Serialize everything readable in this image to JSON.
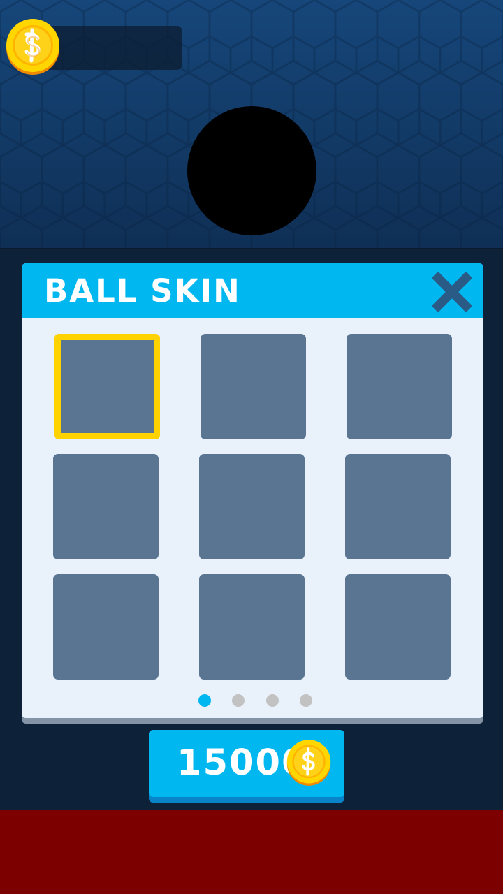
{
  "hud": {
    "coin_balance": "",
    "coin_icon": "coin-icon"
  },
  "preview": {
    "ball_color": "#000000"
  },
  "skin_panel": {
    "title": "BALL SKIN",
    "close_icon": "close-icon",
    "slots": [
      {
        "selected": true
      },
      {
        "selected": false
      },
      {
        "selected": false
      },
      {
        "selected": false
      },
      {
        "selected": false
      },
      {
        "selected": false
      },
      {
        "selected": false
      },
      {
        "selected": false
      },
      {
        "selected": false
      }
    ],
    "pages": {
      "count": 4,
      "current": 1
    }
  },
  "unlock": {
    "price": "15000",
    "currency_icon": "coin-icon"
  },
  "colors": {
    "accent": "#00b8ef",
    "selected_border": "#ffd200",
    "slot": "#5a7591",
    "panel_bg": "#e9f2fb",
    "bottom_band": "#7d0000"
  }
}
